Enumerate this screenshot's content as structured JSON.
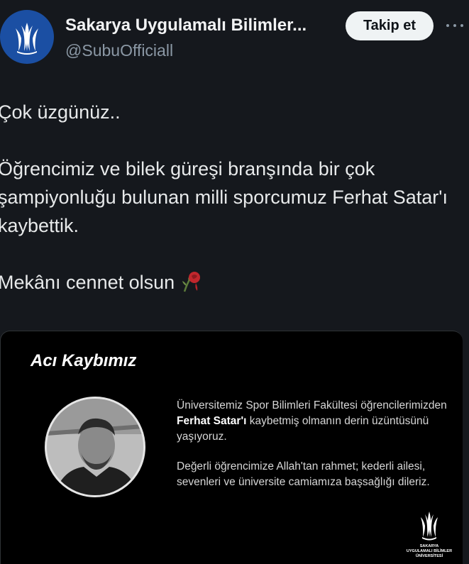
{
  "account": {
    "display_name": "Sakarya Uygulamalı Bilimler...",
    "handle": "@SubuOfficiall",
    "follow_label": "Takip et",
    "more_label": "···"
  },
  "tweet": {
    "line1": "Çok üzgünüz..",
    "line2": "Öğrencimiz ve bilek güreşi branşında bir çok şampiyonluğu bulunan milli sporcumuz Ferhat Satar'ı kaybettik.",
    "line3": "Mekânı cennet olsun"
  },
  "card": {
    "title": "Acı Kaybımız",
    "para1_start": "Üniversitemiz Spor Bilimleri Fakültesi öğrencilerimizden ",
    "para1_name": "Ferhat Satar'ı",
    "para1_end": " kaybetmiş olmanın derin üzüntüsünü yaşıyoruz.",
    "para2": "Değerli öğrencimize Allah'tan rahmet; kederli ailesi, sevenleri ve üniversite camiamıza başsağlığı dileriz.",
    "logo_text_1": "SAKARYA",
    "logo_text_2": "UYGULAMALI BİLİMLER",
    "logo_text_3": "ÜNİVERSİTESİ"
  },
  "icons": {
    "avatar": "university-logo-icon",
    "emoji": "wilted-rose-icon",
    "more": "more-options-icon"
  },
  "colors": {
    "background": "#15181d",
    "avatar_blue": "#1b4fa3",
    "follow_button": "#eff3f4",
    "secondary_text": "#8b98a5"
  }
}
